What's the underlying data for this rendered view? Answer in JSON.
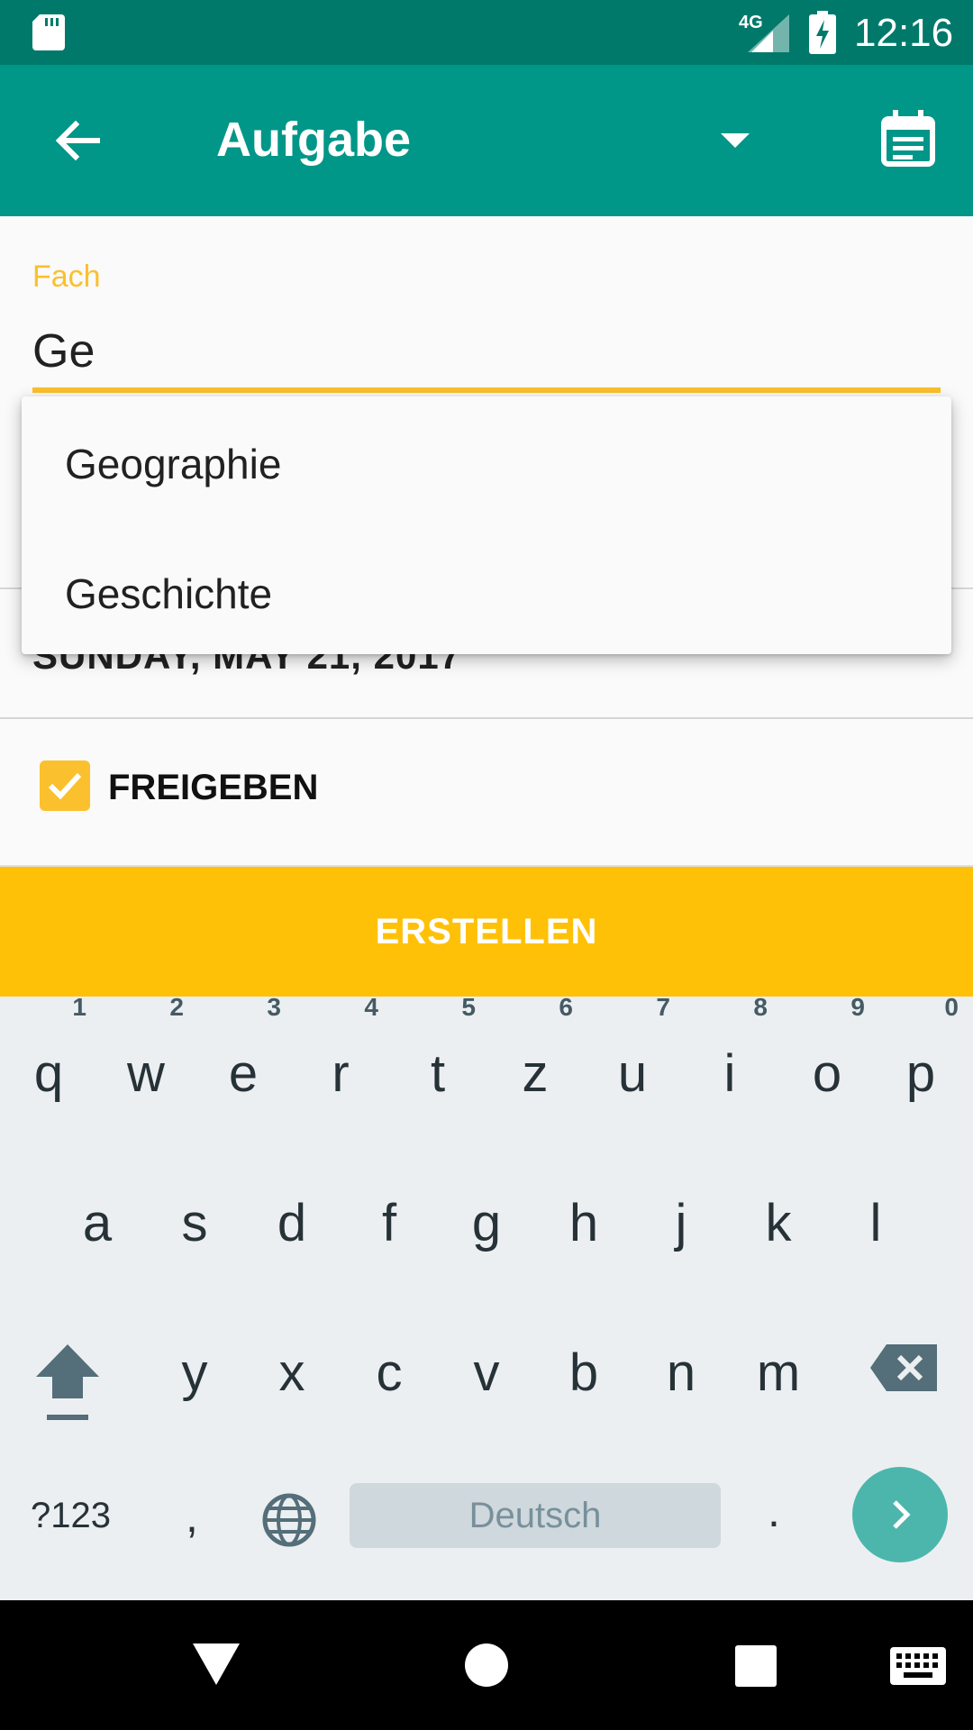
{
  "status_bar": {
    "network_label": "4G",
    "time": "12:16",
    "icons": [
      "sd-card-icon",
      "signal-icon",
      "battery-charging-icon"
    ]
  },
  "app_bar": {
    "title": "Aufgabe",
    "icons": [
      "back-arrow-icon",
      "dropdown-caret-icon",
      "calendar-icon"
    ],
    "color": "#009688"
  },
  "form": {
    "subject_label": "Fach",
    "subject_value": "Ge",
    "date_text": "SUNDAY, MAY 21, 2017",
    "share_checkbox_label": "FREIGEBEN",
    "share_checked": true,
    "create_button_label": "ERSTELLEN",
    "accent_color": "#ffc107"
  },
  "autocomplete": {
    "options": [
      "Geographie",
      "Geschichte"
    ]
  },
  "keyboard": {
    "row1": [
      {
        "key": "q",
        "hint": "1"
      },
      {
        "key": "w",
        "hint": "2"
      },
      {
        "key": "e",
        "hint": "3"
      },
      {
        "key": "r",
        "hint": "4"
      },
      {
        "key": "t",
        "hint": "5"
      },
      {
        "key": "z",
        "hint": "6"
      },
      {
        "key": "u",
        "hint": "7"
      },
      {
        "key": "i",
        "hint": "8"
      },
      {
        "key": "o",
        "hint": "9"
      },
      {
        "key": "p",
        "hint": "0"
      }
    ],
    "row2": [
      "a",
      "s",
      "d",
      "f",
      "g",
      "h",
      "j",
      "k",
      "l"
    ],
    "row3": [
      "y",
      "x",
      "c",
      "v",
      "b",
      "n",
      "m"
    ],
    "symbols_key": "?123",
    "comma_key": ",",
    "space_label": "Deutsch",
    "period_key": "."
  },
  "nav_bar": {
    "icons": [
      "nav-back-icon",
      "nav-home-icon",
      "nav-recents-icon",
      "keyboard-switch-icon"
    ]
  }
}
